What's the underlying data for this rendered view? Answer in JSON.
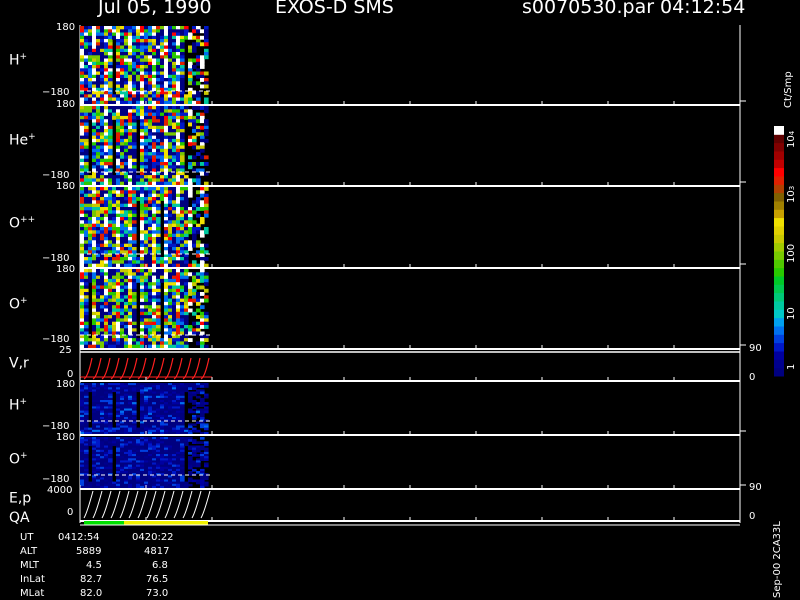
{
  "header": {
    "date": "Jul 05, 1990",
    "instrument": "EXOS-D SMS",
    "file": "s0070530.par",
    "time": "04:12:54"
  },
  "colorbar": {
    "unit_label": "Ct/Smp",
    "ticks": [
      "1",
      "10",
      "100",
      "10",
      "10"
    ],
    "tick_exponents": [
      "",
      "",
      "",
      "3",
      "4"
    ],
    "tick_values": [
      1,
      10,
      100,
      1000,
      10000
    ],
    "colors": [
      "#000080",
      "#00008c",
      "#0000a0",
      "#0018c8",
      "#0040e0",
      "#0070f0",
      "#00a0f0",
      "#00c8c8",
      "#00c8a0",
      "#00c878",
      "#00c850",
      "#00c828",
      "#28c800",
      "#50c800",
      "#78c800",
      "#a0c800",
      "#c8c800",
      "#e0d000",
      "#f0e000",
      "#c8a000",
      "#a08000",
      "#806000",
      "#b04000",
      "#e02000",
      "#ff0000",
      "#c00000",
      "#a00000",
      "#800000",
      "#600000",
      "#ffffff"
    ]
  },
  "chart_data": {
    "type": "heatmap",
    "panels": [
      {
        "label_main": "H",
        "label_sup": "+",
        "y_top": "180",
        "y_bottom": "−180",
        "ylim": [
          -180,
          180
        ]
      },
      {
        "label_main": "He",
        "label_sup": "+",
        "y_top": "180",
        "y_bottom": "−180",
        "ylim": [
          -180,
          180
        ]
      },
      {
        "label_main": "O",
        "label_sup": "++",
        "y_top": "180",
        "y_bottom": "−180",
        "ylim": [
          -180,
          180
        ]
      },
      {
        "label_main": "O",
        "label_sup": "+",
        "y_top": "180",
        "y_bottom": "−180",
        "ylim": [
          -180,
          180
        ]
      },
      {
        "label_main": "V,r",
        "label_sup": "",
        "y_top": "25",
        "y_bottom": "0",
        "right_top": "90",
        "right_bottom": "0",
        "ylim": [
          0,
          25
        ]
      },
      {
        "label_main": "H",
        "label_sup": "+",
        "y_top": "180",
        "y_bottom": "−180",
        "ylim": [
          -180,
          180
        ]
      },
      {
        "label_main": "O",
        "label_sup": "+",
        "y_top": "180",
        "y_bottom": "−180",
        "ylim": [
          -180,
          180
        ]
      },
      {
        "label_main": "E,p",
        "label_sup": "",
        "y_top": "4000",
        "y_bottom": "0",
        "right_top": "90",
        "right_bottom": "0",
        "ylim": [
          0,
          4000
        ]
      }
    ],
    "qa_label": "QA",
    "time_range": [
      "0412:54",
      "0420:22"
    ]
  },
  "ephemeris": {
    "rows": [
      {
        "name": "UT",
        "v1": "0412:54",
        "v2": "0420:22"
      },
      {
        "name": "ALT",
        "v1": "5889",
        "v2": "4817"
      },
      {
        "name": "MLT",
        "v1": "4.5",
        "v2": "6.8"
      },
      {
        "name": "InLat",
        "v1": "82.7",
        "v2": "76.5"
      },
      {
        "name": "MLat",
        "v1": "82.0",
        "v2": "73.0"
      }
    ]
  },
  "footer_code": "Sep-00 2CA33L"
}
